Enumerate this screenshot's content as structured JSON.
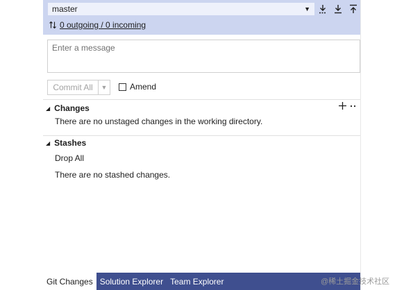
{
  "branch": {
    "selected": "master"
  },
  "sync": {
    "status_link": "0 outgoing / 0 incoming"
  },
  "commit": {
    "message_placeholder": "Enter a message",
    "commit_label": "Commit All",
    "amend_label": "Amend"
  },
  "changes": {
    "title": "Changes",
    "empty_text": "There are no unstaged changes in the working directory."
  },
  "stashes": {
    "title": "Stashes",
    "drop_all": "Drop All",
    "empty_text": "There are no stashed changes."
  },
  "tabs": [
    {
      "label": "Git Changes",
      "active": true
    },
    {
      "label": "Solution Explorer",
      "active": false
    },
    {
      "label": "Team Explorer",
      "active": false
    }
  ],
  "watermark": "@稀土掘金技术社区",
  "colors": {
    "header_bg": "#ccd5f0",
    "tab_bar_bg": "#3f4f8f",
    "active_tab_bg": "#ffffff"
  }
}
